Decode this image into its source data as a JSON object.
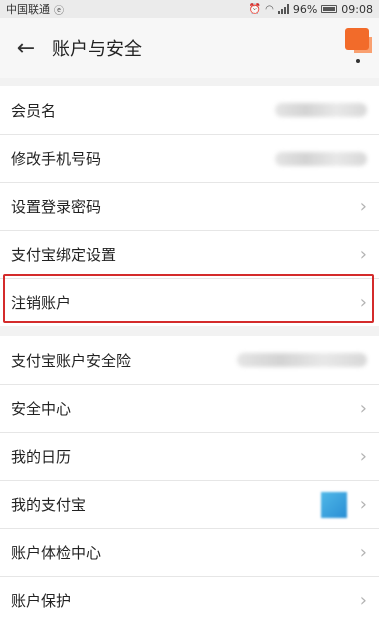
{
  "status": {
    "carrier": "中国联通",
    "net_icon": "ⓔ",
    "battery_pct": "96%",
    "time": "09:08",
    "icons": [
      "alarm-icon",
      "wifi-icon",
      "signal-icon",
      "battery-icon"
    ]
  },
  "navbar": {
    "back_label": "←",
    "title": "账户与安全"
  },
  "group1": {
    "items": [
      {
        "label": "会员名",
        "value_state": "blurred"
      },
      {
        "label": "修改手机号码",
        "value_state": "blurred"
      },
      {
        "label": "设置登录密码"
      },
      {
        "label": "支付宝绑定设置"
      },
      {
        "label": "注销账户"
      }
    ]
  },
  "group2": {
    "items": [
      {
        "label": "支付宝账户安全险",
        "value_state": "blurred"
      },
      {
        "label": "安全中心"
      },
      {
        "label": "我的日历"
      },
      {
        "label": "我的支付宝",
        "value_state": "blurred-thumbnail"
      },
      {
        "label": "账户体检中心"
      },
      {
        "label": "账户保护"
      }
    ]
  },
  "chevron": "›",
  "colors": {
    "highlight": "#d42b2b",
    "avatar": "#f26b2a",
    "thumbnail": "#2a8ed4"
  }
}
